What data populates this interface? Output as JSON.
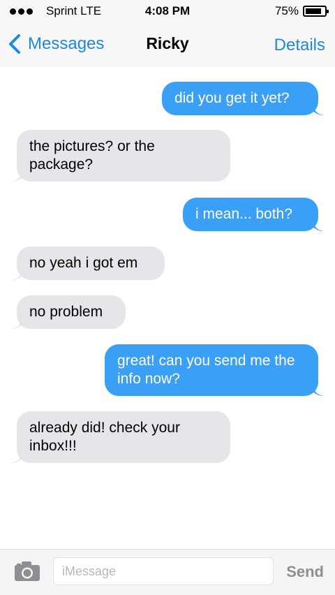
{
  "status_bar": {
    "carrier": "Sprint  LTE",
    "time": "4:08 PM",
    "battery": "75%",
    "battery_level": 0.75
  },
  "nav": {
    "back_label": "Messages",
    "title": "Ricky",
    "details_label": "Details"
  },
  "messages": [
    {
      "direction": "sent",
      "text": "did you get it yet?"
    },
    {
      "direction": "received",
      "text": "the pictures? or the package?"
    },
    {
      "direction": "sent",
      "text": "i mean... both?"
    },
    {
      "direction": "received",
      "text": "no yeah i got em"
    },
    {
      "direction": "received",
      "text": "no problem"
    },
    {
      "direction": "sent",
      "text": "great! can you send me the info now?"
    },
    {
      "direction": "received",
      "text": "already did! check your inbox!!!"
    }
  ],
  "input_bar": {
    "camera_icon": "camera-icon",
    "placeholder": "iMessage",
    "send_label": "Send"
  },
  "colors": {
    "accent": "#1e88e5",
    "sent_bubble": "#3aa0f5",
    "received_bubble": "#e6e5ea",
    "send_disabled": "#8e8e93"
  }
}
